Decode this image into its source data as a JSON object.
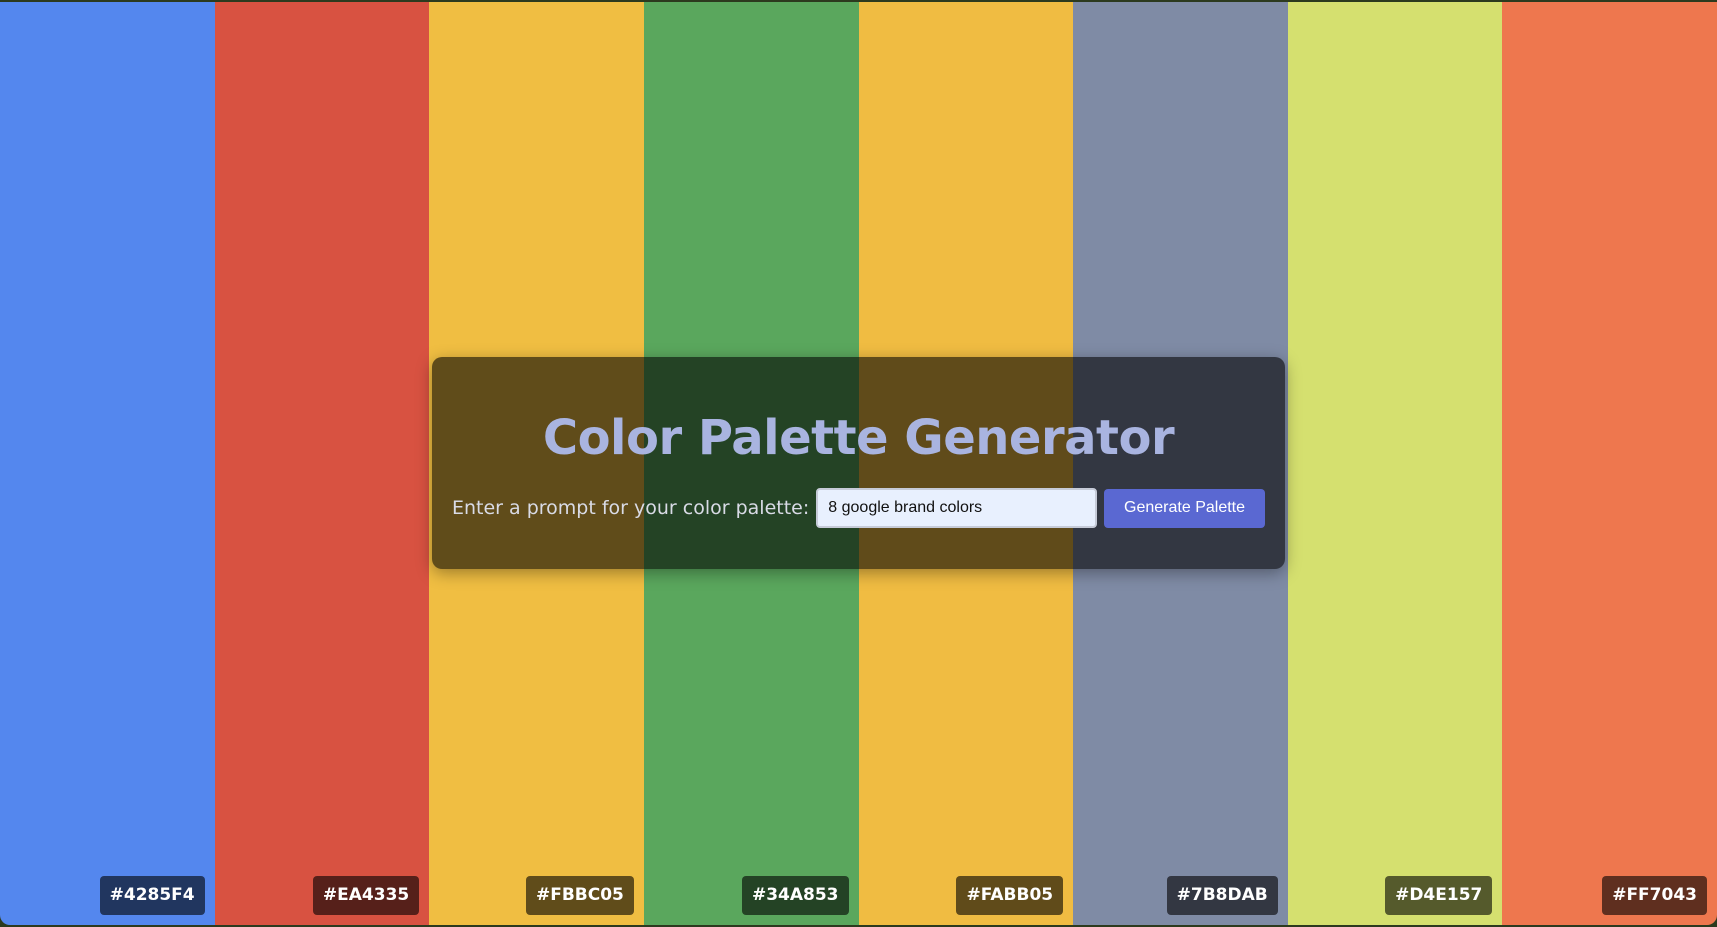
{
  "app": {
    "title": "Color Palette Generator"
  },
  "prompt": {
    "label": "Enter a prompt for your color palette:",
    "value": "8 google brand colors",
    "placeholder": ""
  },
  "actions": {
    "generate_label": "Generate Palette"
  },
  "palette": {
    "swatches": [
      {
        "hex": "#4285F4",
        "display_color": "#5487ee"
      },
      {
        "hex": "#EA4335",
        "display_color": "#d85241"
      },
      {
        "hex": "#FBBC05",
        "display_color": "#f0be42"
      },
      {
        "hex": "#34A853",
        "display_color": "#5aa75d"
      },
      {
        "hex": "#FABB05",
        "display_color": "#f0bc42"
      },
      {
        "hex": "#7B8DAB",
        "display_color": "#7f8ba5"
      },
      {
        "hex": "#D4E157",
        "display_color": "#d5e06f"
      },
      {
        "hex": "#FF7043",
        "display_color": "#ee774e"
      }
    ]
  },
  "colors": {
    "panel_overlay": "rgba(0,0,0,0.6)",
    "title_text": "#a9b4e0",
    "button_bg": "#5a68d2",
    "input_bg": "#e8f0fe"
  }
}
